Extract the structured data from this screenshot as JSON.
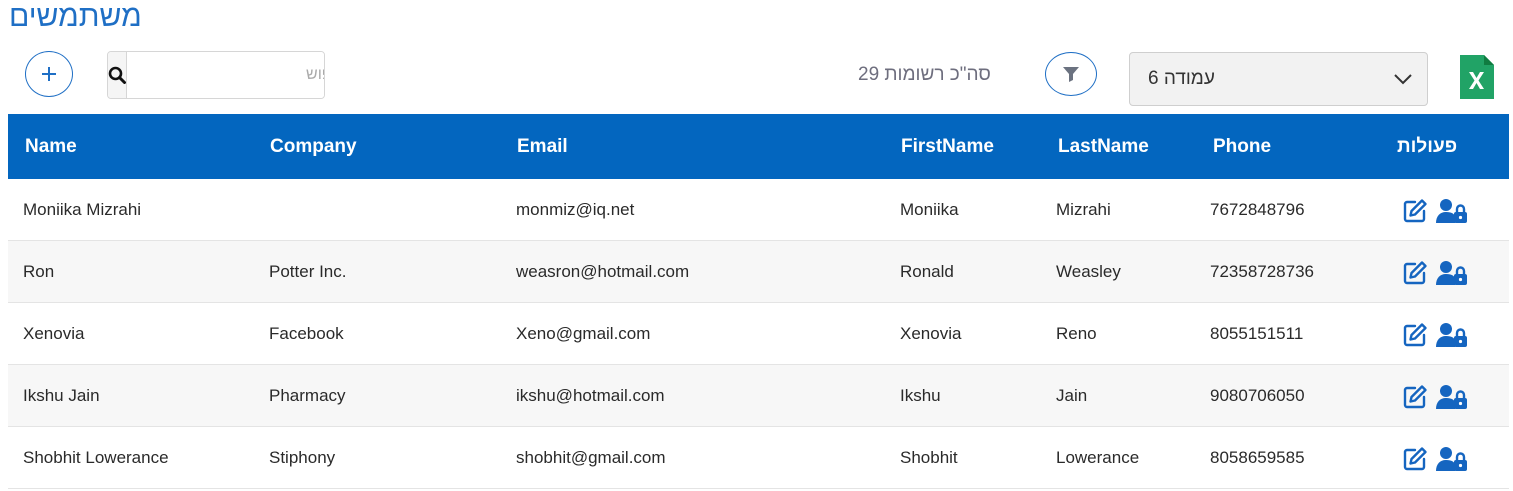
{
  "page": {
    "title": "משתמשים"
  },
  "toolbar": {
    "search_placeholder": "חיפוש",
    "total_label": "סה\"כ רשומות 29",
    "page_select_value": "עמודה 6",
    "add_icon": "plus-icon",
    "filter_icon": "funnel-icon",
    "excel_icon": "excel-icon"
  },
  "colors": {
    "accent": "#1f6fc5",
    "header_bg": "#0366bf",
    "excel_green": "#21a366"
  },
  "table": {
    "headers": [
      "Name",
      "Company",
      "Email",
      "FirstName",
      "LastName",
      "Phone",
      "פעולות"
    ],
    "rows": [
      {
        "name": "Moniika Mizrahi",
        "company": "",
        "email": "monmiz@iq.net",
        "first": "Moniika",
        "last": "Mizrahi",
        "phone": "7672848796"
      },
      {
        "name": "Ron",
        "company": "Potter Inc.",
        "email": "weasron@hotmail.com",
        "first": "Ronald",
        "last": "Weasley",
        "phone": "72358728736"
      },
      {
        "name": "Xenovia",
        "company": "Facebook",
        "email": "Xeno@gmail.com",
        "first": "Xenovia",
        "last": "Reno",
        "phone": "8055151511"
      },
      {
        "name": "Ikshu Jain",
        "company": "Pharmacy",
        "email": "ikshu@hotmail.com",
        "first": "Ikshu",
        "last": "Jain",
        "phone": "9080706050"
      },
      {
        "name": "Shobhit Lowerance",
        "company": "Stiphony",
        "email": "shobhit@gmail.com",
        "first": "Shobhit",
        "last": "Lowerance",
        "phone": "8058659585"
      }
    ],
    "row_actions": [
      "edit-icon",
      "user-lock-icon"
    ]
  }
}
